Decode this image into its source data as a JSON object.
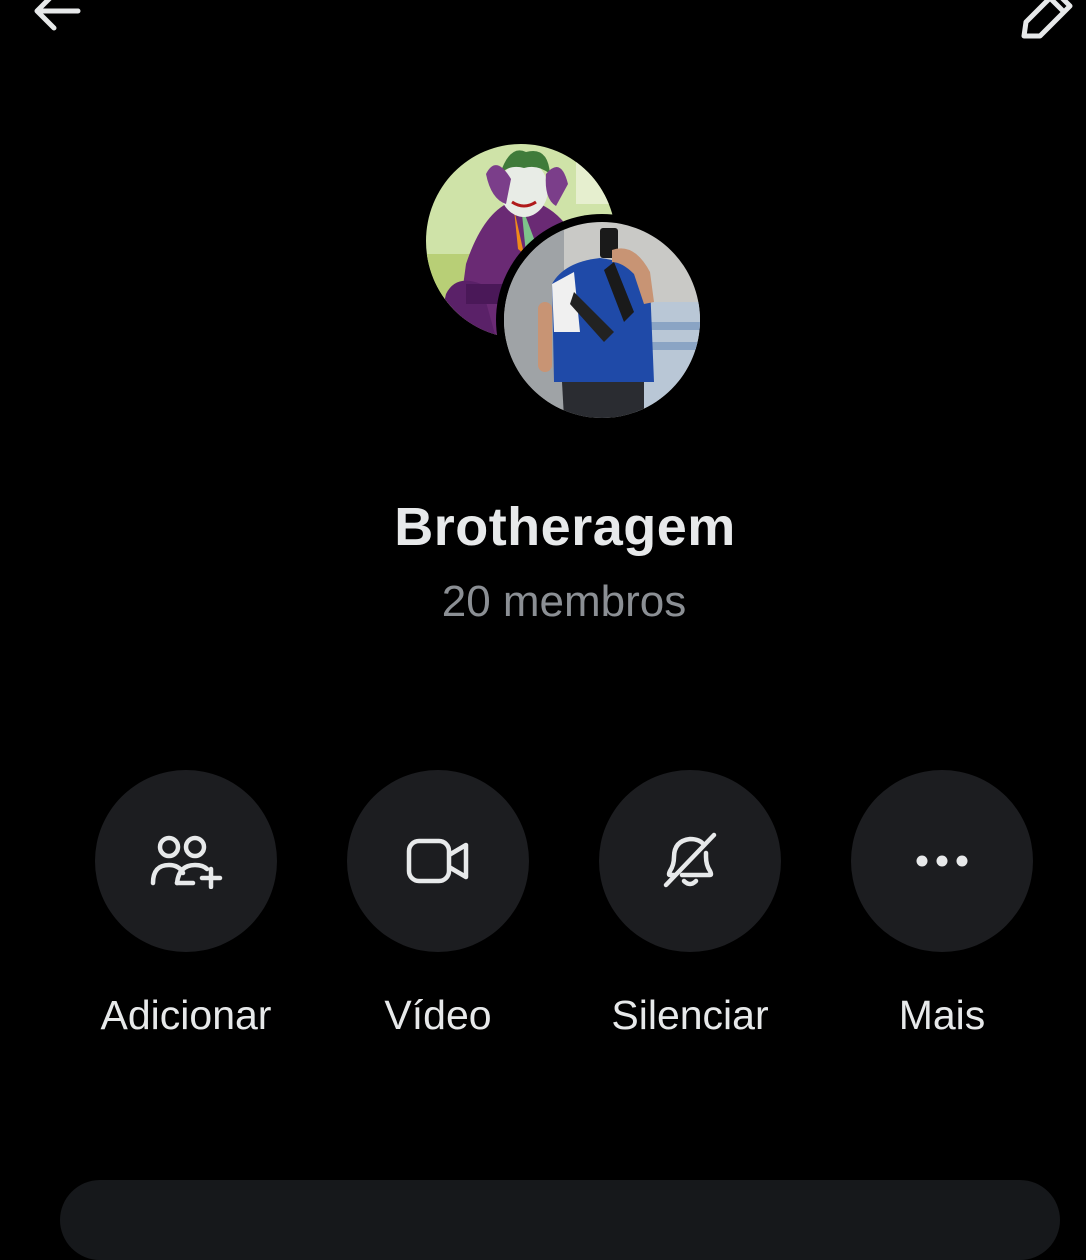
{
  "header": {
    "back_icon": "arrow-left-icon",
    "edit_icon": "pencil-icon"
  },
  "group": {
    "name": "Brotheragem",
    "members": "20 membros"
  },
  "actions": [
    {
      "label": "Adicionar",
      "icon": "add-people-icon"
    },
    {
      "label": "Vídeo",
      "icon": "video-camera-icon"
    },
    {
      "label": "Silenciar",
      "icon": "bell-off-icon"
    },
    {
      "label": "Mais",
      "icon": "more-horizontal-icon"
    }
  ],
  "colors": {
    "background": "#000000",
    "text_primary": "#e7e9ea",
    "text_secondary": "#8b8f94",
    "button_bg": "#1c1d20"
  }
}
